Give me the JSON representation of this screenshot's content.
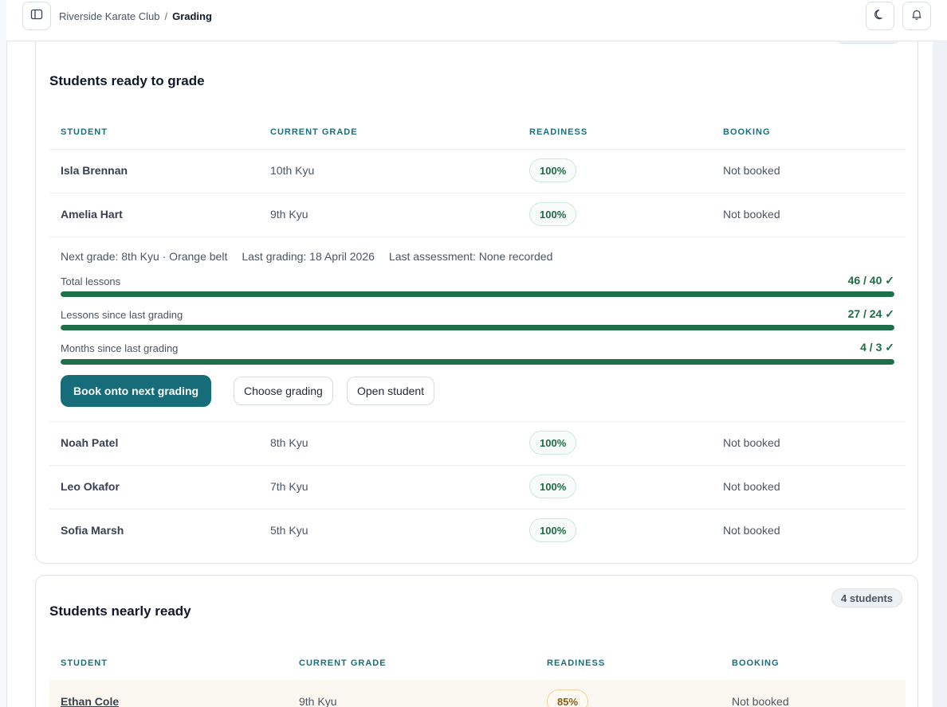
{
  "breadcrumb": {
    "club": "Riverside Karate Club",
    "separator": "/",
    "current": "Grading"
  },
  "icons": {
    "sidebar": "sidebar-toggle-icon",
    "theme": "moon-icon",
    "notifications": "bell-icon"
  },
  "ready_section": {
    "title": "Students ready to grade",
    "headers": [
      "STUDENT",
      "CURRENT GRADE",
      "READINESS",
      "BOOKING"
    ],
    "rows": [
      {
        "name": "Isla Brennan",
        "grade": "10th Kyu",
        "readiness": "100%",
        "booking": "Not booked"
      },
      {
        "name": "Amelia Hart",
        "grade": "9th Kyu",
        "readiness": "100%",
        "booking": "Not booked"
      },
      {
        "name": "Noah Patel",
        "grade": "8th Kyu",
        "readiness": "100%",
        "booking": "Not booked"
      },
      {
        "name": "Leo Okafor",
        "grade": "7th Kyu",
        "readiness": "100%",
        "booking": "Not booked"
      },
      {
        "name": "Sofia Marsh",
        "grade": "5th Kyu",
        "readiness": "100%",
        "booking": "Not booked"
      }
    ],
    "expanded": {
      "next_grade": "Next grade: 8th Kyu · Orange belt",
      "last_grading": "Last grading: 18 April 2026",
      "last_assessment": "Last assessment: None recorded",
      "progress": [
        {
          "label": "Total lessons",
          "value": "46 / 40 ✓",
          "fraction": 1.0
        },
        {
          "label": "Lessons since last grading",
          "value": "27 / 24 ✓",
          "fraction": 1.0
        },
        {
          "label": "Months since last grading",
          "value": "4 / 3 ✓",
          "fraction": 1.0
        }
      ],
      "actions": {
        "book": "Book onto next grading",
        "choose": "Choose grading",
        "open": "Open student"
      }
    }
  },
  "nearly_section": {
    "title": "Students nearly ready",
    "count": "4 students",
    "headers": [
      "STUDENT",
      "CURRENT GRADE",
      "READINESS",
      "BOOKING"
    ],
    "rows": [
      {
        "name": "Ethan Cole",
        "grade": "9th Kyu",
        "readiness": "85%",
        "booking": "Not booked"
      }
    ]
  },
  "colors": {
    "accent": "#166c78",
    "success": "#1f7048",
    "warning": "#8a5a12"
  }
}
